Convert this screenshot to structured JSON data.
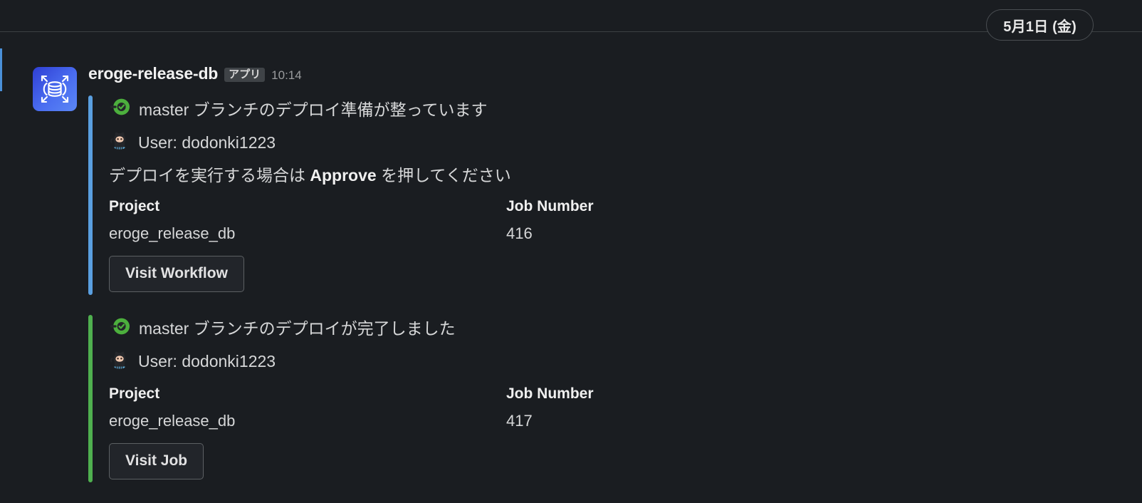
{
  "theme": {
    "background": "#1a1d21",
    "divider": "#3c4043",
    "text": "#d6d7d8",
    "text_strong": "#f1f1f1",
    "muted": "#9a9c9e",
    "accent_blue": "#5a9fe0",
    "accent_green": "#4fb04f",
    "edge_strip": "#4a90d9"
  },
  "date_divider": {
    "label": "5月1日 (金)"
  },
  "message": {
    "avatar_icon": "database-expand-icon",
    "sender": "eroge-release-db",
    "app_badge": "アプリ",
    "timestamp": "10:14",
    "attachments": [
      {
        "bar_color": "#5a9fe0",
        "status_icon": "circleci-success-icon",
        "title": "master ブランチのデプロイ準備が整っています",
        "user_emoji": "octocat-emoji",
        "user_line": "User: dodonki1223",
        "text_before": "デプロイを実行する場合は ",
        "text_bold": "Approve",
        "text_after": " を押してください",
        "fields": [
          {
            "title": "Project",
            "value": "eroge_release_db"
          },
          {
            "title": "Job Number",
            "value": "416"
          }
        ],
        "button": "Visit Workflow"
      },
      {
        "bar_color": "#4fb04f",
        "status_icon": "circleci-success-icon",
        "title": "master ブランチのデプロイが完了しました",
        "user_emoji": "octocat-emoji",
        "user_line": "User: dodonki1223",
        "text_before": "",
        "text_bold": "",
        "text_after": "",
        "fields": [
          {
            "title": "Project",
            "value": "eroge_release_db"
          },
          {
            "title": "Job Number",
            "value": "417"
          }
        ],
        "button": "Visit Job"
      }
    ]
  }
}
